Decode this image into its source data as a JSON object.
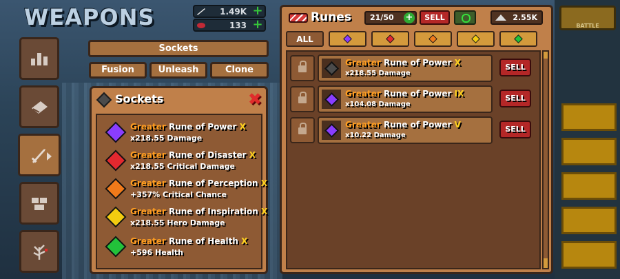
{
  "header": {
    "title": "WEAPONS",
    "currencies": [
      {
        "icon": "sword-damage-icon",
        "value": "1.49K"
      },
      {
        "icon": "ruby-icon",
        "value": "133"
      }
    ]
  },
  "battle_label": "BATTLE",
  "nav": [
    {
      "icon": "stats-icon"
    },
    {
      "icon": "book-icon"
    },
    {
      "icon": "sword-icon",
      "active": true
    },
    {
      "icon": "pets-icon"
    },
    {
      "icon": "skill-tree-icon"
    }
  ],
  "sockets_header": "Sockets",
  "buttons": {
    "fusion": "Fusion",
    "unleash": "Unleash",
    "clone": "Clone"
  },
  "sockets_panel": {
    "title": "Sockets",
    "items": [
      {
        "greater": "Greater",
        "name": "Rune of Power",
        "rank": "X",
        "value": "x218.55",
        "stat": "Damage",
        "color": "#8a3dff"
      },
      {
        "greater": "Greater",
        "name": "Rune of Disaster",
        "rank": "X",
        "value": "x218.55",
        "stat": "Critical Damage",
        "color": "#e3282f"
      },
      {
        "greater": "Greater",
        "name": "Rune of Perception",
        "rank": "X",
        "value": "+357%",
        "stat": "Critical Chance",
        "color": "#f07a1a"
      },
      {
        "greater": "Greater",
        "name": "Rune of Inspiration",
        "rank": "X",
        "value": "x218.55",
        "stat": "Hero Damage",
        "color": "#f2cc10"
      },
      {
        "greater": "Greater",
        "name": "Rune of Health",
        "rank": "X",
        "value": "+596",
        "stat": "Health",
        "color": "#22c23a"
      }
    ]
  },
  "runes_panel": {
    "title": "Runes",
    "count": "21/50",
    "sell_label": "SELL",
    "dust": "2.55K",
    "filters": [
      {
        "label": "ALL"
      },
      {
        "color": "#8a3dff"
      },
      {
        "color": "#e3282f"
      },
      {
        "color": "#f07a1a"
      },
      {
        "color": "#f2cc10"
      },
      {
        "color": "#22c23a"
      }
    ],
    "runes": [
      {
        "greater": "Greater",
        "name": "Rune of Power",
        "rank": "X",
        "value": "x218.55",
        "stat": "Damage",
        "color": "#4b4b4b",
        "sell": "SELL"
      },
      {
        "greater": "Greater",
        "name": "Rune of Power",
        "rank": "IX",
        "value": "x104.08",
        "stat": "Damage",
        "color": "#8a3dff",
        "sell": "SELL"
      },
      {
        "greater": "Greater",
        "name": "Rune of Power",
        "rank": "V",
        "value": "x10.22",
        "stat": "Damage",
        "color": "#8a3dff",
        "sell": "SELL"
      }
    ]
  }
}
